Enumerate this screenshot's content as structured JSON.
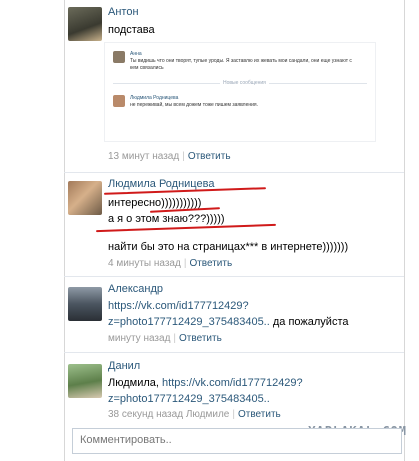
{
  "comments": [
    {
      "author": "Антон",
      "text": "подстава",
      "time": "13 минут назад",
      "reply": "Ответить",
      "screenshot": {
        "first": {
          "name": "Анна",
          "text": "Ты видишь что они творят, тупые уроды. Я заставлю их жевать мои сандали, они еще узнают с кем связались"
        },
        "divider": "Новые сообщения",
        "second": {
          "name": "Людмила Родницева",
          "text": "не переживай, мы всем дожем тоже пишем заявления."
        }
      }
    },
    {
      "author": "Людмила Родницева",
      "lines": [
        "интересно)))))))))))",
        "а я о этом знаю???)))))",
        "",
        "найти бы это на страницах*** в интернете)))))))"
      ],
      "time": "4 минуты назад",
      "reply": "Ответить"
    },
    {
      "author": "Александр",
      "link1": "https://vk.com/id177712429?",
      "link2": "z=photo177712429_375483405..",
      "tail": " да пожалуйста",
      "time": "минуту назад",
      "reply": "Ответить"
    },
    {
      "author": "Данил",
      "prefix": "Людмила, ",
      "link1": "https://vk.com/id177712429?",
      "link2": "z=photo177712429_375483405..",
      "time": "38 секунд назад",
      "to": "Людмиле",
      "reply": "Ответить"
    }
  ],
  "input": {
    "placeholder": "Комментировать.."
  },
  "watermark": "YAPLAKAL.COM",
  "colors": {
    "link": "#2b587a",
    "meta": "#999999",
    "annotation": "#d01a1a"
  }
}
